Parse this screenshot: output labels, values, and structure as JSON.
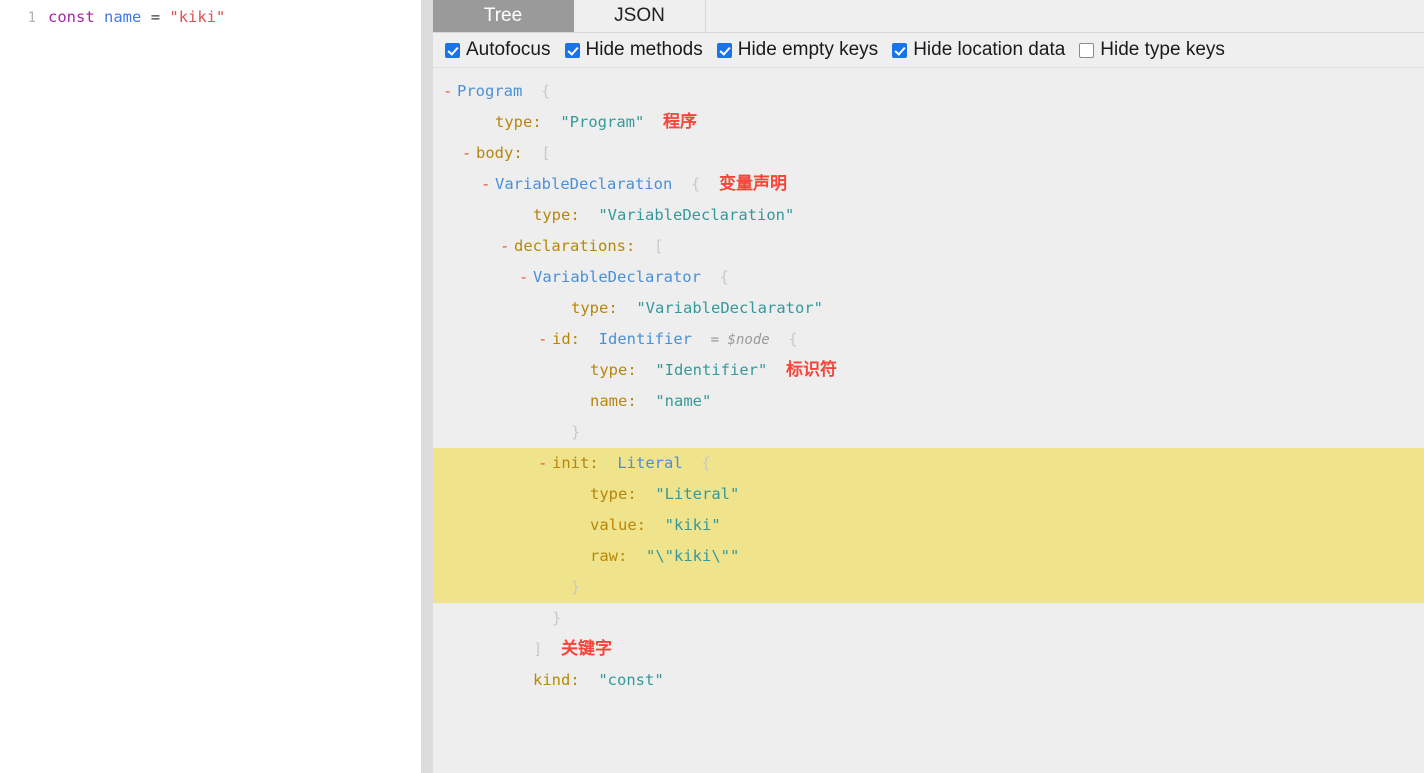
{
  "editor": {
    "line_number": "1",
    "tokens": [
      {
        "text": "const",
        "kind": "keyword"
      },
      {
        "text": " ",
        "kind": "plain"
      },
      {
        "text": "name",
        "kind": "variable"
      },
      {
        "text": " ",
        "kind": "plain"
      },
      {
        "text": "=",
        "kind": "operator"
      },
      {
        "text": " ",
        "kind": "plain"
      },
      {
        "text": "\"kiki\"",
        "kind": "string"
      }
    ],
    "full_text": "const name = \"kiki\""
  },
  "tabs": [
    {
      "id": "tree",
      "label": "Tree",
      "active": true
    },
    {
      "id": "json",
      "label": "JSON",
      "active": false
    }
  ],
  "options": [
    {
      "id": "autofocus",
      "label": "Autofocus",
      "checked": true
    },
    {
      "id": "hide-methods",
      "label": "Hide methods",
      "checked": true
    },
    {
      "id": "hide-empty-keys",
      "label": "Hide empty keys",
      "checked": true
    },
    {
      "id": "hide-location-data",
      "label": "Hide location data",
      "checked": true
    },
    {
      "id": "hide-type-keys",
      "label": "Hide type keys",
      "checked": false
    }
  ],
  "colors": {
    "accent_checkbox": "#1a73e8",
    "active_tab_bg": "#9a9a9a",
    "tree_bg": "#eeeeee",
    "highlight_bg": "#efe38c",
    "node_type": "#4a90d9",
    "key": "#b8860b",
    "string": "#35999b",
    "brace": "#c9c9c9",
    "toggle": "#e05a3a",
    "annotation": "#f8443a"
  },
  "tree": [
    {
      "indent": 0,
      "toggle": "-",
      "node": "Program",
      "brace": "{",
      "highlight": false
    },
    {
      "indent": 2,
      "toggle": "",
      "key": "type:",
      "str": "\"Program\"",
      "annotation": "程序",
      "highlight": false
    },
    {
      "indent": 1,
      "toggle": "-",
      "key": "body:",
      "brace": "[",
      "highlight": false
    },
    {
      "indent": 2,
      "toggle": "-",
      "node": "VariableDeclaration",
      "brace": "{",
      "annotation": "变量声明",
      "highlight": false
    },
    {
      "indent": 4,
      "toggle": "",
      "key": "type:",
      "str": "\"VariableDeclaration\"",
      "highlight": false
    },
    {
      "indent": 3,
      "toggle": "-",
      "key": "declarations:",
      "brace": "[",
      "highlight": false
    },
    {
      "indent": 4,
      "toggle": "-",
      "node": "VariableDeclarator",
      "brace": "{",
      "highlight": false
    },
    {
      "indent": 6,
      "toggle": "",
      "key": "type:",
      "str": "\"VariableDeclarator\"",
      "highlight": false
    },
    {
      "indent": 5,
      "toggle": "-",
      "key": "id:",
      "node": "Identifier",
      "alias": "= $node",
      "brace": "{",
      "highlight": false
    },
    {
      "indent": 7,
      "toggle": "",
      "key": "type:",
      "str": "\"Identifier\"",
      "annotation": "标识符",
      "highlight": false
    },
    {
      "indent": 7,
      "toggle": "",
      "key": "name:",
      "str": "\"name\"",
      "highlight": false
    },
    {
      "indent": 6,
      "toggle": "",
      "brace": "}",
      "highlight": false
    },
    {
      "indent": 5,
      "toggle": "-",
      "key": "init:",
      "node": "Literal",
      "brace": "{",
      "highlight": true
    },
    {
      "indent": 7,
      "toggle": "",
      "key": "type:",
      "str": "\"Literal\"",
      "highlight": true
    },
    {
      "indent": 7,
      "toggle": "",
      "key": "value:",
      "str": "\"kiki\"",
      "highlight": true
    },
    {
      "indent": 7,
      "toggle": "",
      "key": "raw:",
      "str": "\"\\\"kiki\\\"\"",
      "highlight": true
    },
    {
      "indent": 6,
      "toggle": "",
      "brace": "}",
      "highlight": true
    },
    {
      "indent": 5,
      "toggle": "",
      "brace": "}",
      "highlight": false
    },
    {
      "indent": 4,
      "toggle": "",
      "brace": "]",
      "annotation": "关键字",
      "highlight": false
    },
    {
      "indent": 4,
      "toggle": "",
      "key": "kind:",
      "str": "\"const\"",
      "highlight": false
    }
  ]
}
